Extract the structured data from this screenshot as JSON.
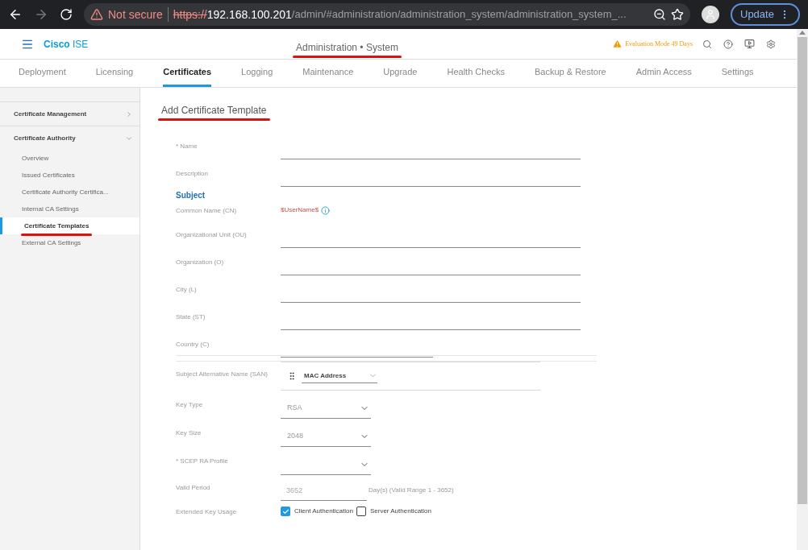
{
  "browser": {
    "security": "Not secure",
    "url_scheme": "https://",
    "url_host": "192.168.100.201",
    "url_path": "/admin/#administration/administration_system/administration_system_...",
    "update_button": "Update"
  },
  "header": {
    "brand_bold": "Cisco",
    "brand_light": "ISE",
    "title": "Administration • System",
    "title_underlined": true,
    "evaluation": "Evaluation Mode 49 Days"
  },
  "tabs": [
    {
      "label": "Deployment",
      "selected": false
    },
    {
      "label": "Licensing",
      "selected": false
    },
    {
      "label": "Certificates",
      "selected": true
    },
    {
      "label": "Logging",
      "selected": false
    },
    {
      "label": "Maintenance",
      "selected": false
    },
    {
      "label": "Upgrade",
      "selected": false
    },
    {
      "label": "Health Checks",
      "selected": false
    },
    {
      "label": "Backup & Restore",
      "selected": false
    },
    {
      "label": "Admin Access",
      "selected": false
    },
    {
      "label": "Settings",
      "selected": false
    }
  ],
  "sidebar": {
    "groups": [
      {
        "label": "Certificate Management",
        "expanded": false
      },
      {
        "label": "Certificate Authority",
        "expanded": true,
        "children": [
          {
            "label": "Overview",
            "selected": false,
            "underlined": false
          },
          {
            "label": "Issued Certificates",
            "selected": false,
            "underlined": false
          },
          {
            "label": "Certificate Authority Certifica...",
            "selected": false,
            "underlined": false
          },
          {
            "label": "Internal CA Settings",
            "selected": false,
            "underlined": false
          },
          {
            "label": "Certificate Templates",
            "selected": true,
            "underlined": true
          },
          {
            "label": "External CA Settings",
            "selected": false,
            "underlined": false
          }
        ]
      }
    ]
  },
  "form": {
    "title": "Add Certificate Template",
    "title_underlined": true,
    "rows": [
      {
        "kind": "text",
        "label": "* Name"
      },
      {
        "kind": "text",
        "label": "Description"
      },
      {
        "kind": "heading",
        "label": "Subject"
      },
      {
        "kind": "static",
        "label": "Common Name (CN)",
        "value": "$UserName$"
      },
      {
        "kind": "text",
        "label": "Organizational Unit (OU)"
      },
      {
        "kind": "text",
        "label": "Organization (O)"
      },
      {
        "kind": "text",
        "label": "City (L)"
      },
      {
        "kind": "text",
        "label": "State (ST)"
      },
      {
        "kind": "short",
        "label": "Country (C)"
      },
      {
        "kind": "san",
        "label": "Subject Alternative Name (SAN)",
        "value": "MAC Address"
      },
      {
        "kind": "select",
        "label": "Key Type",
        "value": "RSA"
      },
      {
        "kind": "select",
        "label": "Key Size",
        "value": "2048"
      },
      {
        "kind": "select",
        "label": "* SCEP RA Profile"
      },
      {
        "kind": "period",
        "label": "Valid Period",
        "value": "3652",
        "hint": "Day(s) (Valid Range 1 - 3652)"
      },
      {
        "kind": "checks",
        "label": "Extended Key Usage",
        "options": [
          {
            "label": "Client Authentication",
            "checked": true
          },
          {
            "label": "Server Authentication",
            "checked": false
          }
        ]
      }
    ]
  }
}
